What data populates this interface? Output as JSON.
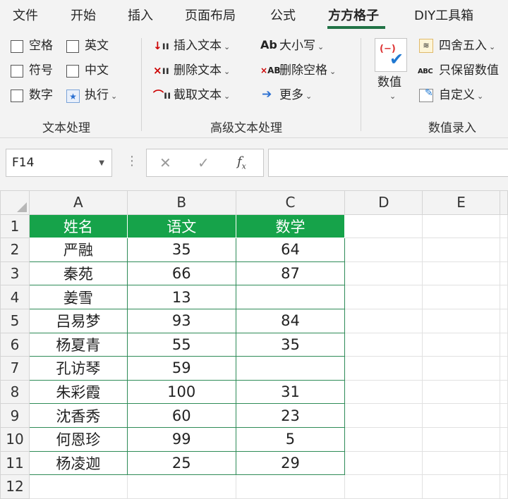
{
  "ribbon_tabs": [
    {
      "label": "文件",
      "active": false
    },
    {
      "label": "开始",
      "active": false
    },
    {
      "label": "插入",
      "active": false
    },
    {
      "label": "页面布局",
      "active": false
    },
    {
      "label": "公式",
      "active": false
    },
    {
      "label": "方方格子",
      "active": true
    },
    {
      "label": "DIY工具箱",
      "active": false
    }
  ],
  "ribbon": {
    "text_group": {
      "label": "文本处理",
      "checkboxes": {
        "space": "空格",
        "english": "英文",
        "symbol": "符号",
        "chinese": "中文",
        "digit": "数字"
      },
      "execute": "执行"
    },
    "adv_group": {
      "label": "高级文本处理",
      "insert_text": "插入文本",
      "delete_text": "删除文本",
      "extract_text": "截取文本",
      "case": "大小写",
      "delete_spaces": "删除空格",
      "more": "更多",
      "case_icon": "Ab",
      "del_space_icon": "AB"
    },
    "num_group": {
      "label": "数值录入",
      "value": "数值",
      "round": "四舍五入",
      "keep_values": "只保留数值",
      "custom": "自定义",
      "keep_icon": "ABC"
    }
  },
  "formula_bar": {
    "name_box": "F14",
    "formula": ""
  },
  "sheet": {
    "columns": [
      "A",
      "B",
      "C",
      "D",
      "E"
    ],
    "rows": [
      "1",
      "2",
      "3",
      "4",
      "5",
      "6",
      "7",
      "8",
      "9",
      "10",
      "11",
      "12"
    ],
    "headers": [
      "姓名",
      "语文",
      "数学"
    ],
    "data": [
      [
        "严融",
        "35",
        "64"
      ],
      [
        "秦苑",
        "66",
        "87"
      ],
      [
        "姜雪",
        "13",
        ""
      ],
      [
        "吕易梦",
        "93",
        "84"
      ],
      [
        "杨夏青",
        "55",
        "35"
      ],
      [
        "孔访琴",
        "59",
        ""
      ],
      [
        "朱彩霞",
        "100",
        "31"
      ],
      [
        "沈香秀",
        "60",
        "23"
      ],
      [
        "何恩珍",
        "99",
        "5"
      ],
      [
        "杨凌迦",
        "25",
        "29"
      ]
    ],
    "header_color": "#16a34a",
    "border_color": "#2e8b57"
  }
}
